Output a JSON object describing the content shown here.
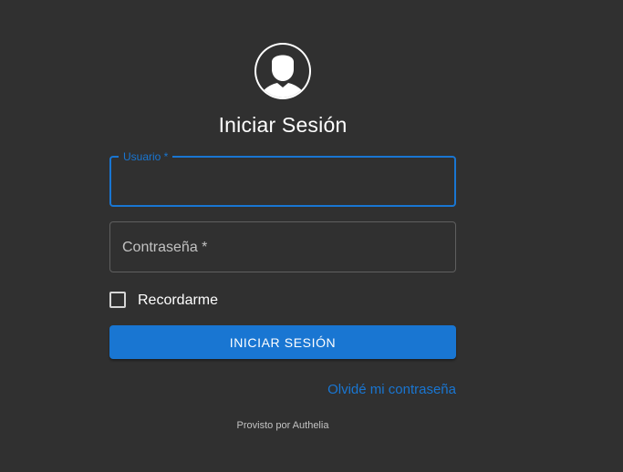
{
  "login": {
    "title": "Iniciar Sesión",
    "username": {
      "label": "Usuario *",
      "value": ""
    },
    "password": {
      "label": "Contraseña *",
      "value": ""
    },
    "remember_label": "Recordarme",
    "remember_checked": false,
    "submit_label": "INICIAR SESIÓN",
    "forgot_label": "Olvidé mi contraseña",
    "footer": "Provisto por Authelia"
  },
  "colors": {
    "background": "#303030",
    "accent": "#1976d2",
    "text": "#ffffff"
  },
  "icons": {
    "avatar": "user-avatar-icon"
  }
}
